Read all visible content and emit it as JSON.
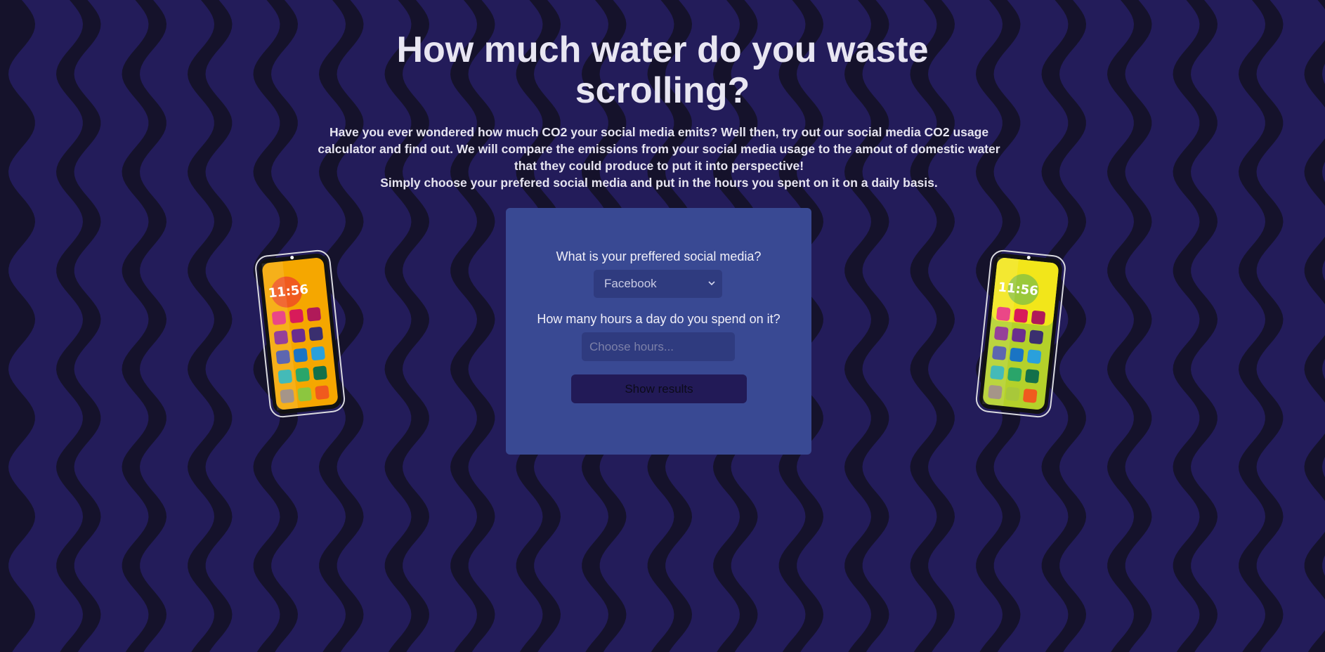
{
  "page": {
    "title": "How much water do you waste scrolling?",
    "intro_lines": [
      "Have you ever wondered how much CO2 your social media emits? Well then, try out our social media CO2 usage calculator and find out. We will compare the emissions from your social media usage to the amout of domestic water that they could produce to put it into perspective!",
      "Simply choose your prefered social media and put in the hours you spent on it on a daily basis."
    ]
  },
  "form": {
    "social_label": "What is your preffered social media?",
    "social_selected": "Facebook",
    "hours_label": "How many hours a day do you spend on it?",
    "hours_placeholder": "Choose hours...",
    "submit_label": "Show results"
  },
  "phones": {
    "left": {
      "time": "11:56",
      "icon": "smartphone-icon"
    },
    "right": {
      "time": "11:56",
      "icon": "smartphone-icon"
    }
  },
  "colors": {
    "background": "#15122b",
    "wave": "#231c5a",
    "card": "#394993",
    "field": "#2f3b7f",
    "button": "#221a57"
  }
}
